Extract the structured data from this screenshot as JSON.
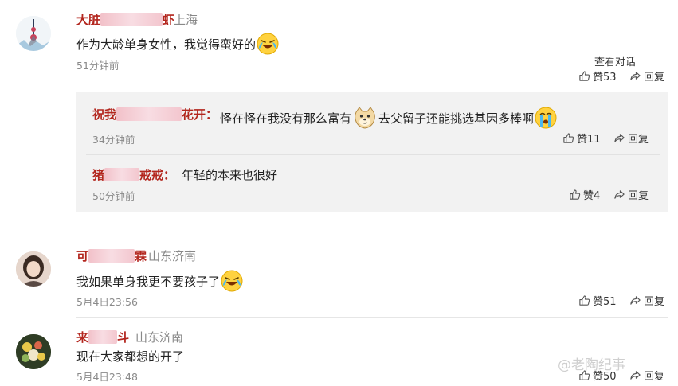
{
  "comments": [
    {
      "name_left": "大脏",
      "name_right": "虾",
      "location": "上海",
      "text": "作为大龄单身女性，我觉得蛮好的",
      "time": "51分钟前",
      "view_replies": "查看对话",
      "likes": "赞53",
      "reply": "回复"
    },
    {
      "name_left": "可",
      "name_right": "霖",
      "location": "山东济南",
      "text": "我如果单身我更不要孩子了",
      "time": "5月4日23:56",
      "likes": "赞51",
      "reply": "回复"
    },
    {
      "name_left": "来",
      "name_right": "斗",
      "location": "山东济南",
      "text": "现在大家都想的开了",
      "time": "5月4日23:48",
      "likes": "赞50",
      "reply": "回复"
    }
  ],
  "replies": [
    {
      "name_left": "祝我",
      "name_right": "花开：",
      "text_a": "怪在怪在我没有那么富有",
      "text_b": "去父留子还能挑选基因多棒啊",
      "time": "34分钟前",
      "likes": "赞11",
      "reply": "回复"
    },
    {
      "name_left": "猪",
      "name_right": "戒戒：",
      "text": "年轻的本来也很好",
      "time": "50分钟前",
      "likes": "赞4",
      "reply": "回复"
    }
  ],
  "watermark": "@老陶纪事",
  "icons": {
    "like": "thumbs-up-icon",
    "reply": "share-arrow-icon",
    "laugh_cry": "laughing-tears-emoji",
    "dog": "doge-emoji",
    "crying": "crying-emoji"
  },
  "colors": {
    "username": "#b3261e",
    "muted": "#8a8a8a",
    "reply_bg": "#f2f2f2"
  }
}
